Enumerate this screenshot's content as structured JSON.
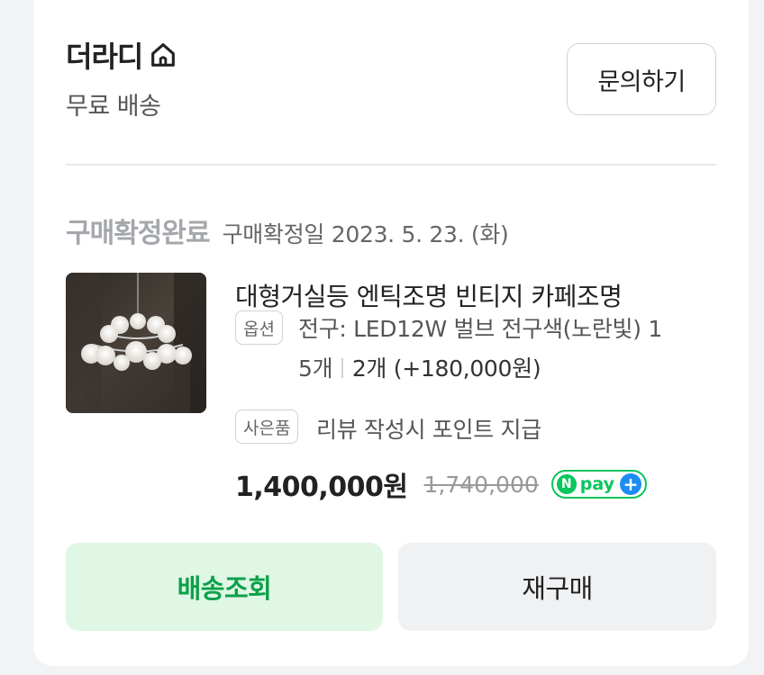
{
  "store": {
    "name": "더라디",
    "shipping": "무료 배송",
    "inquiry_label": "문의하기"
  },
  "order": {
    "status": "구매확정완료",
    "confirm_date": "구매확정일 2023. 5. 23. (화)"
  },
  "product": {
    "title": "대형거실등 엔틱조명 빈티지 카페조명",
    "option_tag": "옵션",
    "option_line1": "전구: LED12W 벌브 전구색(노란빛) 1",
    "option_line2": "5개",
    "quantity": "2개 (+180,000원)",
    "gift_tag": "사은품",
    "gift_text": "리뷰 작성시 포인트 지급",
    "price": "1,400,000원",
    "original_price": "1,740,000",
    "npay_label": "pay"
  },
  "actions": {
    "track_label": "배송조회",
    "rebuy_label": "재구매"
  },
  "colors": {
    "accent_green": "#0ca04a",
    "track_bg": "#dff7e4",
    "npay_green": "#09c65d",
    "npay_blue": "#1d8cf2"
  },
  "icons": {
    "store_icon": "home-icon",
    "npay_plus": "plus-icon"
  }
}
